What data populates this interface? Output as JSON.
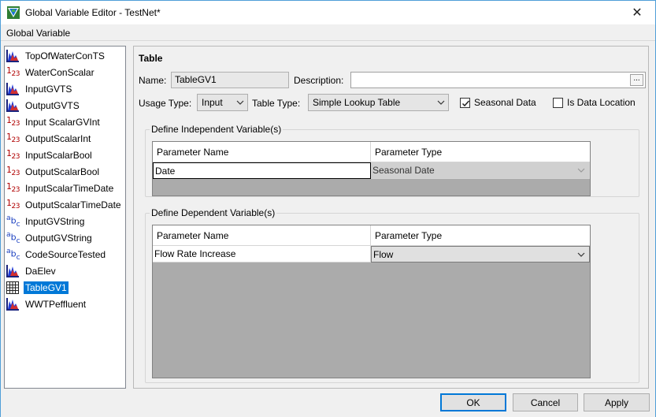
{
  "window": {
    "title": "Global Variable Editor - TestNet*",
    "close_glyph": "✕"
  },
  "menu": {
    "items": [
      "Global Variable"
    ]
  },
  "variables": [
    {
      "label": "TopOfWaterConTS",
      "icon": "timeseries-icon"
    },
    {
      "label": "WaterConScalar",
      "icon": "numeric-icon"
    },
    {
      "label": "InputGVTS",
      "icon": "timeseries-icon"
    },
    {
      "label": "OutputGVTS",
      "icon": "timeseries-icon"
    },
    {
      "label": "Input ScalarGVInt",
      "icon": "numeric-icon"
    },
    {
      "label": "OutputScalarInt",
      "icon": "numeric-icon"
    },
    {
      "label": "InputScalarBool",
      "icon": "numeric-icon"
    },
    {
      "label": "OutputScalarBool",
      "icon": "numeric-icon"
    },
    {
      "label": "InputScalarTimeDate",
      "icon": "numeric-icon"
    },
    {
      "label": "OutputScalarTimeDate",
      "icon": "numeric-icon"
    },
    {
      "label": "InputGVString",
      "icon": "string-icon"
    },
    {
      "label": "OutputGVString",
      "icon": "string-icon"
    },
    {
      "label": "CodeSourceTested",
      "icon": "string-icon"
    },
    {
      "label": "DaElev",
      "icon": "timeseries-icon"
    },
    {
      "label": "TableGV1",
      "icon": "table-icon",
      "selected": true
    },
    {
      "label": "WWTPeffluent",
      "icon": "timeseries-icon"
    }
  ],
  "icon_text": {
    "numeric_main": "1",
    "numeric_sub": "23",
    "string_main": "a",
    "string_b": "b",
    "string_sub": "c"
  },
  "detail": {
    "heading": "Table",
    "name_label": "Name:",
    "name_value": "TableGV1",
    "description_label": "Description:",
    "description_value": "",
    "browse_label": "...",
    "usage_type_label": "Usage Type:",
    "usage_type_value": "Input",
    "table_type_label": "Table Type:",
    "table_type_value": "Simple Lookup Table",
    "seasonal_label": "Seasonal Data",
    "seasonal_checked": true,
    "location_label": "Is Data Location",
    "location_checked": false
  },
  "independent": {
    "legend": "Define Independent Variable(s)",
    "columns": [
      "Parameter Name",
      "Parameter Type"
    ],
    "rows": [
      {
        "name": "Date",
        "type": "Seasonal Date"
      }
    ]
  },
  "dependent": {
    "legend": "Define Dependent Variable(s)",
    "columns": [
      "Parameter Name",
      "Parameter Type"
    ],
    "rows": [
      {
        "name": "Flow Rate Increase",
        "type": "Flow"
      }
    ]
  },
  "buttons": {
    "ok": "OK",
    "cancel": "Cancel",
    "apply": "Apply"
  },
  "colors": {
    "selection": "#0078d7",
    "window_border": "#4f9fd8",
    "numeric_icon": "#b00000",
    "string_icon": "#1a3fc0"
  }
}
